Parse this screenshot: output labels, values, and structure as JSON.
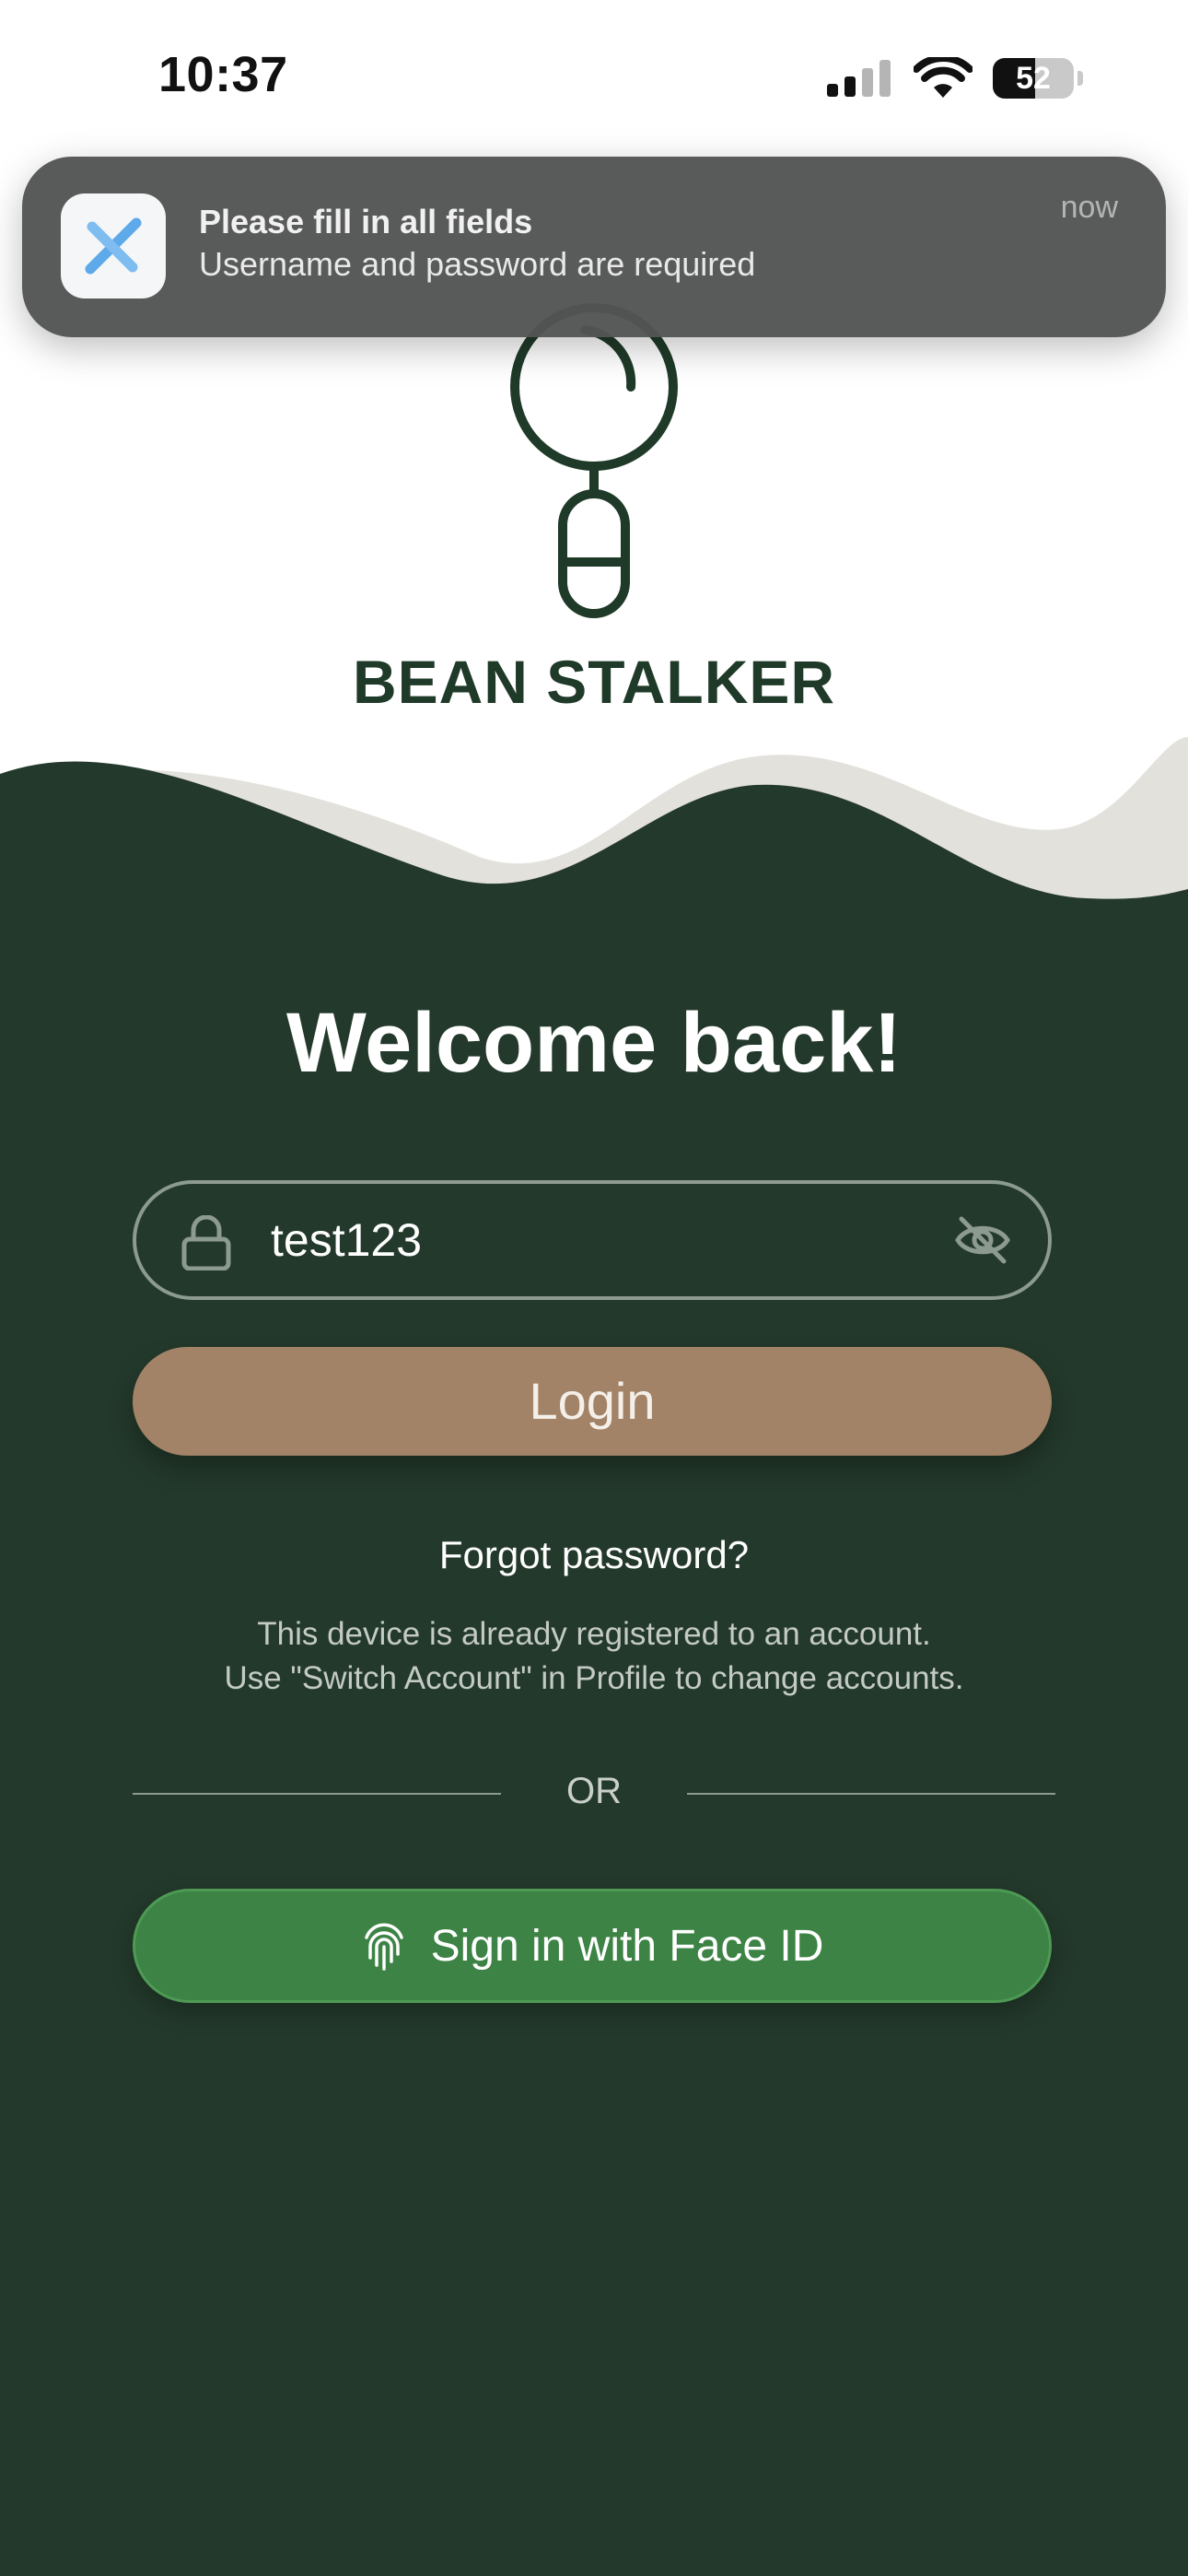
{
  "status_bar": {
    "time": "10:37",
    "battery_level": "52",
    "battery_fraction": 0.52,
    "icons": [
      "cellular-signal-icon",
      "wifi-icon",
      "battery-icon"
    ]
  },
  "notification": {
    "app_icon": "app-logo-icon",
    "title": "Please fill in all fields",
    "body": "Username and password are required",
    "time": "now"
  },
  "brand": {
    "name": "BEAN STALKER",
    "logo": "bean-stalker-logo"
  },
  "login": {
    "welcome_title": "Welcome back!",
    "password_value": "test123",
    "password_icon": "lock-icon",
    "visibility_icon": "eye-off-icon",
    "login_label": "Login",
    "forgot_password": "Forgot password?",
    "device_notice_line1": "This device is already registered to an account.",
    "device_notice_line2": "Use \"Switch Account\" in Profile to change accounts.",
    "divider_text": "OR",
    "faceid_icon": "fingerprint-icon",
    "faceid_label": "Sign in with Face ID"
  },
  "colors": {
    "primary_green": "#23392b",
    "login_button": "#a38367",
    "faceid_button": "#3c8345",
    "wave_accent": "#e3e1dc"
  }
}
